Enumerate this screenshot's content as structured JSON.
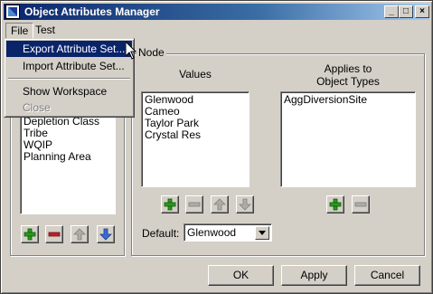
{
  "window": {
    "title": "Object Attributes Manager",
    "controls": {
      "minimize": "_",
      "maximize": "□",
      "close": "×"
    }
  },
  "menubar": {
    "items": [
      {
        "label": "File"
      },
      {
        "label": "Test"
      }
    ]
  },
  "file_menu": {
    "items": [
      {
        "label": "Export Attribute Set...",
        "state": "highlighted"
      },
      {
        "label": "Import Attribute Set...",
        "state": "enabled"
      },
      {
        "label": "Show Workspace",
        "state": "enabled"
      },
      {
        "label": "Close",
        "state": "disabled"
      }
    ]
  },
  "left_panel": {
    "items": [
      "Depletion Class",
      "Tribe",
      "WQIP",
      "Planning Area"
    ],
    "buttons": {
      "add": "add-icon",
      "remove": "remove-icon",
      "up": "up-arrow-icon",
      "down": "down-arrow-icon"
    }
  },
  "right_panel": {
    "group_label": "Node",
    "values": {
      "header": "Values",
      "items": [
        "Glenwood",
        "Cameo",
        "Taylor Park",
        "Crystal Res"
      ]
    },
    "applies_to": {
      "header_line1": "Applies to",
      "header_line2": "Object Types",
      "items": [
        "AggDiversionSite"
      ]
    },
    "default": {
      "label": "Default:",
      "value": "Glenwood"
    }
  },
  "dialog_buttons": {
    "ok": "OK",
    "apply": "Apply",
    "cancel": "Cancel"
  },
  "colors": {
    "title_gradient_start": "#0a246a",
    "title_gradient_end": "#a6caf0",
    "face": "#d4d0c8",
    "highlight": "#0a246a",
    "add_green": "#2a9a1a",
    "remove_red": "#c0202a",
    "down_blue": "#3a6ad8"
  }
}
